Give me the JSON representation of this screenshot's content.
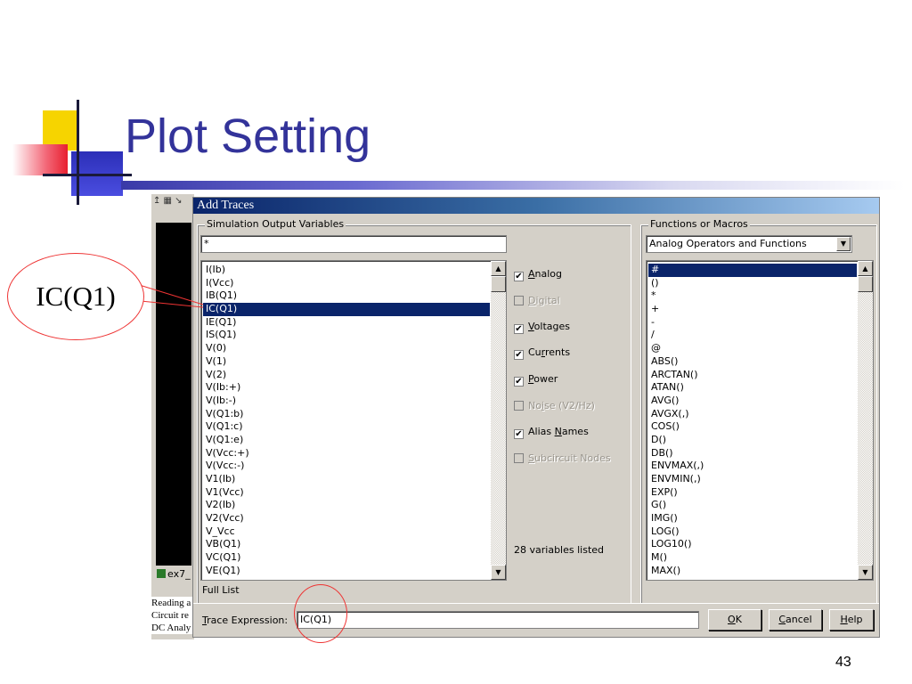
{
  "slide": {
    "title": "Plot Setting",
    "page_number": "43",
    "callout_label": "IC(Q1)"
  },
  "background_app": {
    "tab_label": "ex7_",
    "log_lines": [
      "Reading a",
      "Circuit re",
      "DC Analy"
    ]
  },
  "dialog": {
    "title": "Add Traces",
    "simulation_output": {
      "group_label": "Simulation Output Variables",
      "filter_value": "*",
      "variables": [
        "I(Ib)",
        "I(Vcc)",
        "IB(Q1)",
        "IC(Q1)",
        "IE(Q1)",
        "IS(Q1)",
        "V(0)",
        "V(1)",
        "V(2)",
        "V(Ib:+)",
        "V(Ib:-)",
        "V(Q1:b)",
        "V(Q1:c)",
        "V(Q1:e)",
        "V(Vcc:+)",
        "V(Vcc:-)",
        "V1(Ib)",
        "V1(Vcc)",
        "V2(Ib)",
        "V2(Vcc)",
        "V_Vcc",
        "VB(Q1)",
        "VC(Q1)",
        "VE(Q1)"
      ],
      "selected_variable": "IC(Q1)",
      "full_list_label": "Full List"
    },
    "filters": [
      {
        "pre": "",
        "key": "A",
        "post": "nalog",
        "checked": true,
        "enabled": true
      },
      {
        "pre": "",
        "key": "D",
        "post": "igital",
        "checked": false,
        "enabled": false
      },
      {
        "pre": "",
        "key": "V",
        "post": "oltages",
        "checked": true,
        "enabled": true
      },
      {
        "pre": "Cu",
        "key": "r",
        "post": "rents",
        "checked": true,
        "enabled": true
      },
      {
        "pre": "",
        "key": "P",
        "post": "ower",
        "checked": true,
        "enabled": true
      },
      {
        "pre": "No",
        "key": "i",
        "post": "se (V2/Hz)",
        "checked": false,
        "enabled": false
      },
      {
        "pre": "Alias ",
        "key": "N",
        "post": "ames",
        "checked": true,
        "enabled": true
      },
      {
        "pre": "",
        "key": "S",
        "post": "ubcircuit Nodes",
        "checked": false,
        "enabled": false
      }
    ],
    "variables_count": "28 variables listed",
    "functions": {
      "group_label": "Functions or Macros",
      "selected_category": "Analog Operators and Functions",
      "items": [
        "#",
        "()",
        "*",
        "+",
        "-",
        "/",
        "@",
        "ABS()",
        "ARCTAN()",
        "ATAN()",
        "AVG()",
        "AVGX(,)",
        "COS()",
        "D()",
        "DB()",
        "ENVMAX(,)",
        "ENVMIN(,)",
        "EXP()",
        "G()",
        "IMG()",
        "LOG()",
        "LOG10()",
        "M()",
        "MAX()"
      ],
      "selected_item": "#"
    },
    "trace_expression": {
      "label_key": "T",
      "label_rest": "race Expression:",
      "value": "IC(Q1)"
    },
    "buttons": {
      "ok": {
        "key": "O",
        "rest": "K"
      },
      "cancel": {
        "key": "C",
        "rest": "ancel"
      },
      "help": {
        "key": "H",
        "rest": "elp"
      }
    }
  }
}
